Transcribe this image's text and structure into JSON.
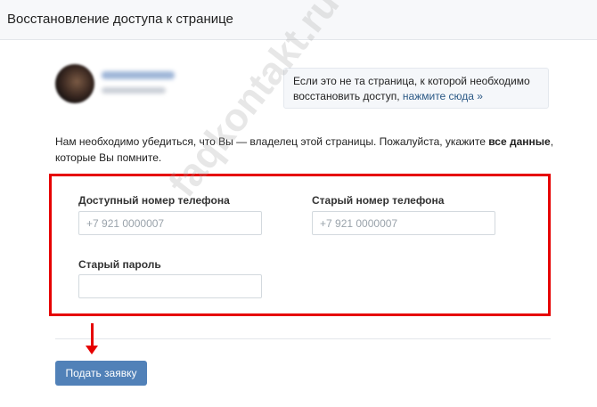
{
  "header": {
    "title": "Восстановление доступа к странице"
  },
  "notice": {
    "text": "Если это не та страница, к которой необходимо восстановить доступ,",
    "link": "нажмите сюда »"
  },
  "intro": {
    "text_before": "Нам необходимо убедиться, что Вы — владелец этой страницы. Пожалуйста, укажите",
    "bold": "все данные",
    "text_after": ", которые Вы помните."
  },
  "form": {
    "phone_available": {
      "label": "Доступный номер телефона",
      "placeholder": "+7 921 0000007",
      "value": ""
    },
    "phone_old": {
      "label": "Старый номер телефона",
      "placeholder": "+7 921 0000007",
      "value": ""
    },
    "password_old": {
      "label": "Старый пароль",
      "placeholder": "",
      "value": ""
    }
  },
  "submit": {
    "label": "Подать заявку"
  },
  "watermark": "faqkontakt.ru",
  "colors": {
    "accent": "#5181b8",
    "link": "#2a5885",
    "highlight": "#e60000"
  }
}
